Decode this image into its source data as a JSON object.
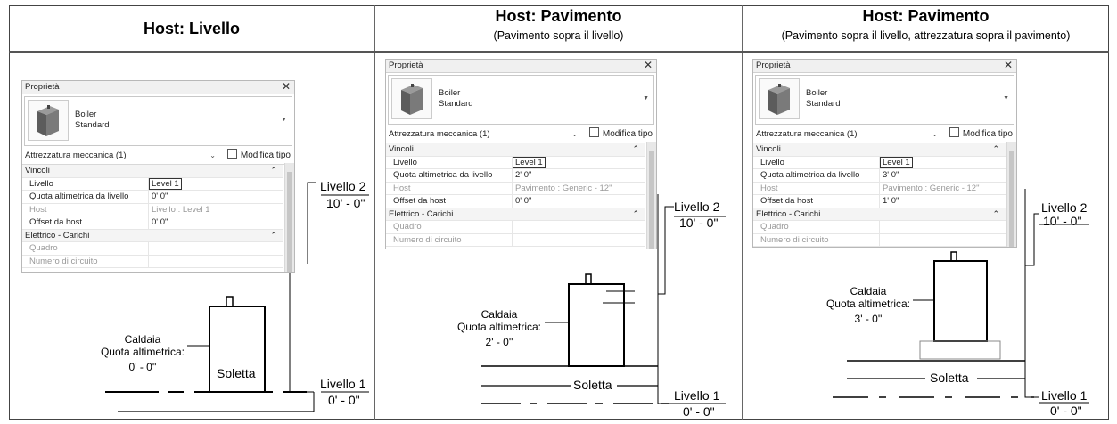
{
  "headers": [
    {
      "title": "Host: Livello",
      "subtitle": ""
    },
    {
      "title": "Host: Pavimento",
      "subtitle": "(Pavimento sopra il livello)"
    },
    {
      "title": "Host: Pavimento",
      "subtitle": "(Pavimento sopra il livello, attrezzatura sopra il pavimento)"
    }
  ],
  "panel": {
    "title": "Proprietà",
    "family": "Boiler",
    "type": "Standard",
    "category": "Attrezzatura meccanica (1)",
    "edit_type": "Modifica tipo",
    "group_constraints": "Vincoli",
    "group_electrical": "Elettrico - Carichi",
    "label_level": "Livello",
    "label_elevation": "Quota altimetrica da livello",
    "label_host": "Host",
    "label_offset": "Offset da host",
    "label_panel": "Quadro",
    "label_circuit": "Numero di circuito"
  },
  "panels": [
    {
      "level": "Level 1",
      "elevation": "0'  0\"",
      "host": "Livello : Level 1",
      "offset": "0'  0\""
    },
    {
      "level": "Level 1",
      "elevation": "2'  0\"",
      "host": "Pavimento : Generic - 12\"",
      "offset": "0'  0\""
    },
    {
      "level": "Level 1",
      "elevation": "3'  0\"",
      "host": "Pavimento : Generic - 12\"",
      "offset": "1'  0\""
    }
  ],
  "diagrams": [
    {
      "boiler_label": "Caldaia",
      "elev_label": "Quota altimetrica:",
      "elev_value": "0' - 0''",
      "slab_label": "Soletta",
      "level2_name": "Livello 2",
      "level2_value": "10' - 0\"",
      "level1_name": "Livello 1",
      "level1_value": "0' - 0\""
    },
    {
      "boiler_label": "Caldaia",
      "elev_label": "Quota altimetrica:",
      "elev_value": "2' - 0''",
      "slab_label": "Soletta",
      "level2_name": "Livello 2",
      "level2_value": "10' - 0\"",
      "level1_name": "Livello 1",
      "level1_value": "0' - 0\""
    },
    {
      "boiler_label": "Caldaia",
      "elev_label": "Quota altimetrica:",
      "elev_value": "3' - 0''",
      "slab_label": "Soletta",
      "level2_name": "Livello 2",
      "level2_value": "10' - 0\"",
      "level1_name": "Livello 1",
      "level1_value": "0' - 0\""
    }
  ]
}
